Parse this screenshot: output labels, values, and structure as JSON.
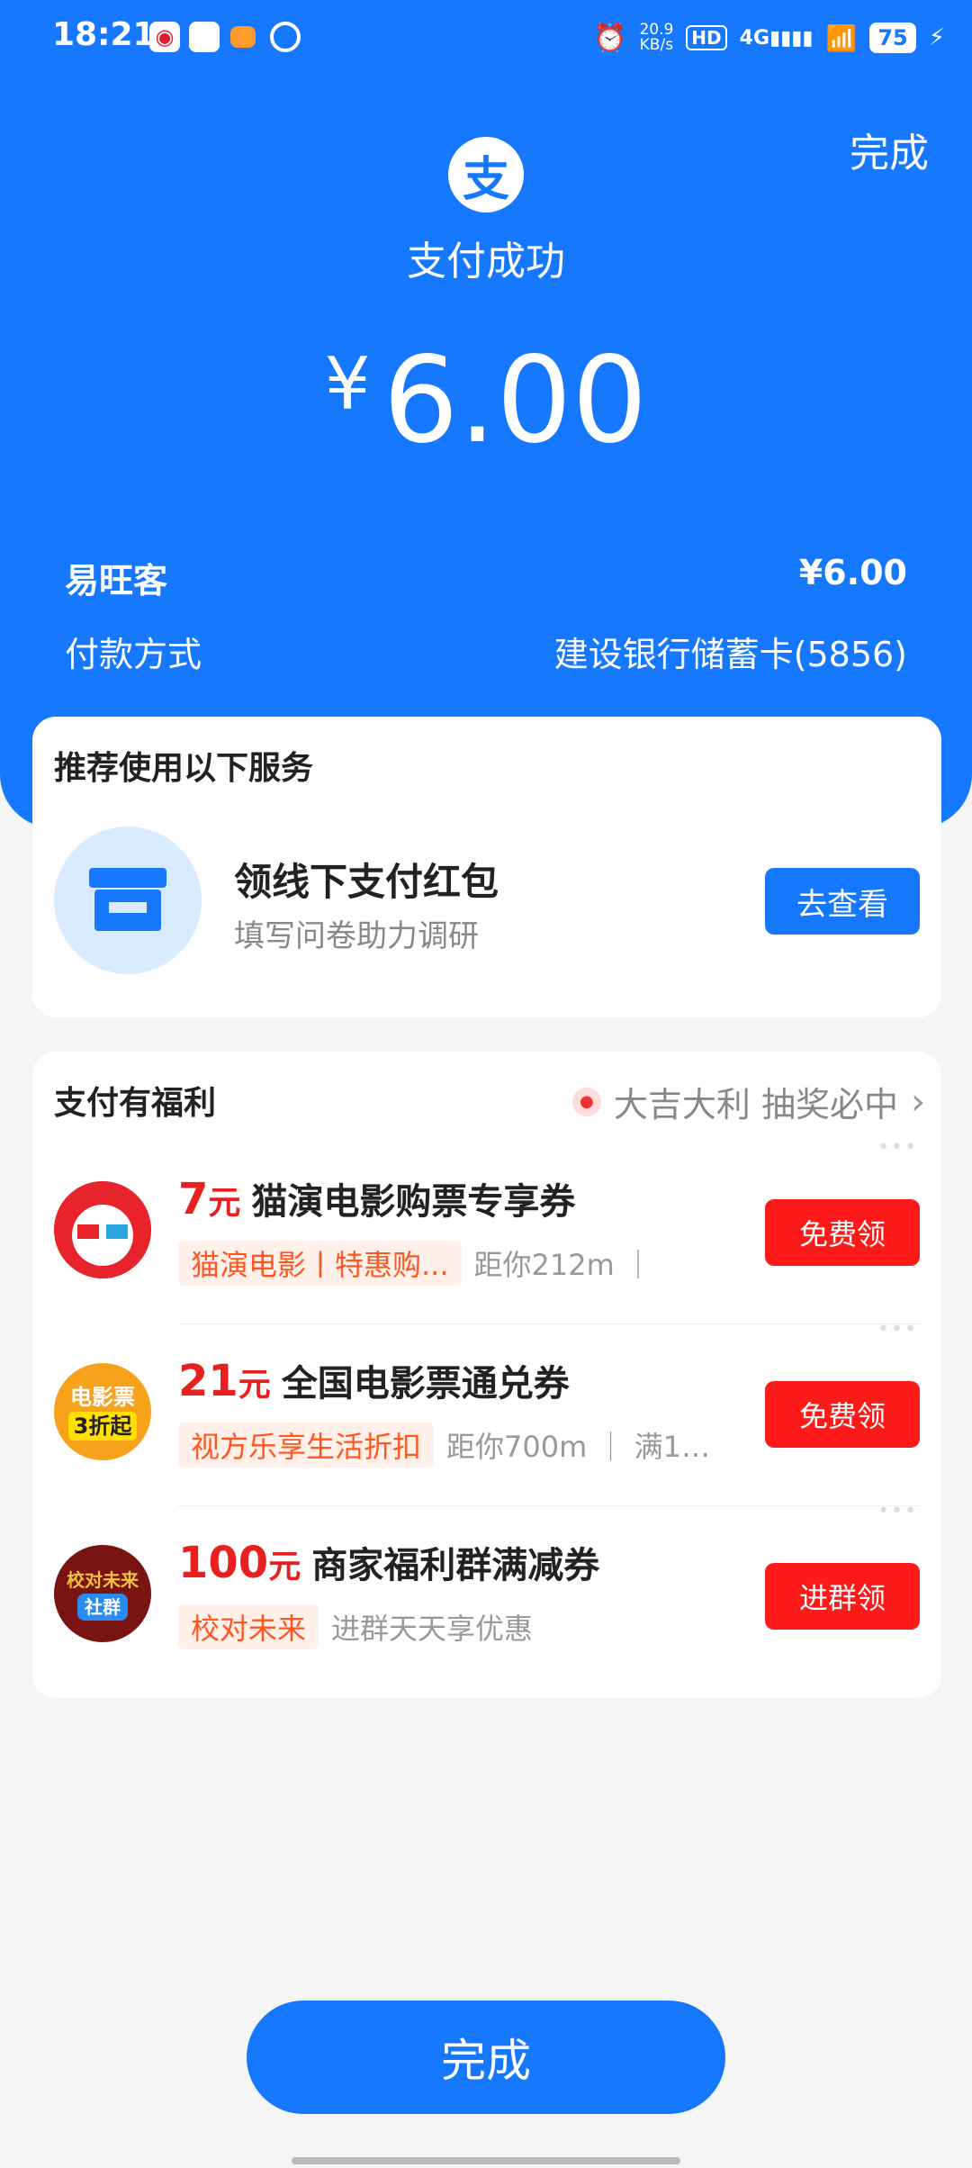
{
  "status_bar": {
    "time": "18:21",
    "network_speed_value": "20.9",
    "network_speed_unit": "KB/s",
    "hd": "HD",
    "signal": "4G",
    "battery": "75"
  },
  "header": {
    "done_label": "完成",
    "logo_char": "支",
    "status_text": "支付成功",
    "currency": "¥",
    "amount": "6.00"
  },
  "details": {
    "merchant": "易旺客",
    "merchant_amount": "¥6.00",
    "pay_method_label": "付款方式",
    "pay_method_value": "建设银行储蓄卡(5856)"
  },
  "recommend": {
    "title": "推荐使用以下服务",
    "item_title": "领线下支付红包",
    "item_subtitle": "填写问卷助力调研",
    "button": "去查看"
  },
  "benefits": {
    "title": "支付有福利",
    "lottery_text": "大吉大利 抽奖必中",
    "items": [
      {
        "amount": "7",
        "unit": "元",
        "name": "猫演电影购票专享券",
        "tag": "猫演电影丨特惠购...",
        "meta": "距你212m ｜",
        "button": "免费领",
        "logo_text": ""
      },
      {
        "amount": "21",
        "unit": "元",
        "name": "全国电影票通兑券",
        "tag": "视方乐享生活折扣",
        "meta": "距你700m ｜ 满1…",
        "button": "免费领",
        "logo_text": "电影票",
        "logo_text_2": "3折起"
      },
      {
        "amount": "100",
        "unit": "元",
        "name": "商家福利群满减券",
        "tag": "校对未来",
        "meta": "进群天天享优惠",
        "button": "进群领",
        "logo_text": "校对未来",
        "logo_text_2": "社群"
      }
    ]
  },
  "footer": {
    "done_button": "完成"
  },
  "colors": {
    "primary": "#1677ff",
    "red": "#ff1a1a",
    "amount_red": "#e82020",
    "tag_orange": "#ff5722"
  }
}
